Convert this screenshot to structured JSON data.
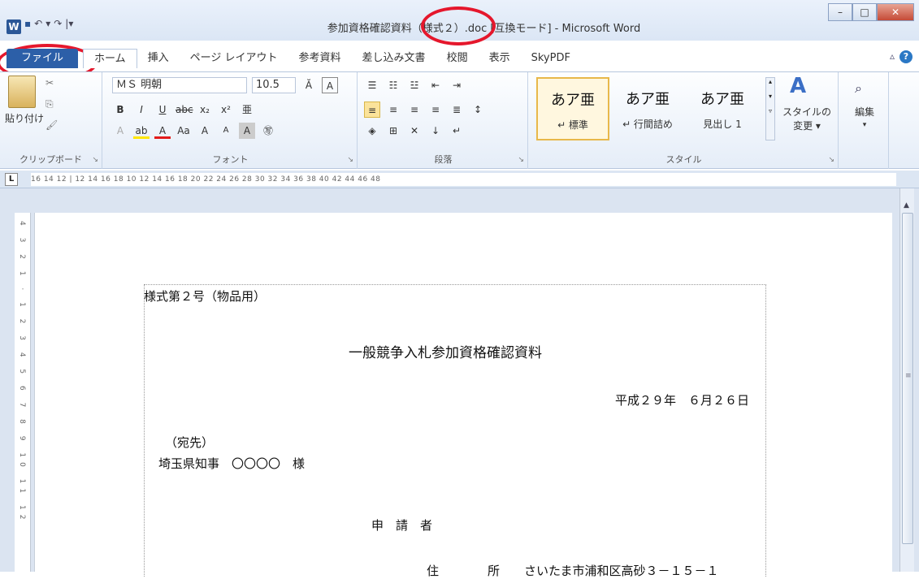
{
  "window": {
    "title": "参加資格確認資料（様式２）.doc [互換モード] - Microsoft Word",
    "app_icon": "W",
    "quick_access": [
      "save-icon",
      "undo-icon",
      "redo-icon",
      "customize-icon"
    ],
    "controls": [
      "minimize",
      "maximize",
      "close"
    ]
  },
  "ribbon_tabs": [
    "ファイル",
    "ホーム",
    "挿入",
    "ページ レイアウト",
    "参考資料",
    "差し込み文書",
    "校閲",
    "表示",
    "SkyPDF"
  ],
  "active_tab": "ホーム",
  "ribbon": {
    "clipboard": {
      "paste_label": "貼り付け",
      "group_label": "クリップボード"
    },
    "font": {
      "font_name": "ＭＳ 明朝",
      "font_size": "10.5",
      "group_label": "フォント",
      "buttons_row2": [
        "B",
        "I",
        "U",
        "abc",
        "x₂",
        "x²"
      ],
      "buttons_row3": [
        "Aa",
        "A",
        "A"
      ]
    },
    "paragraph": {
      "group_label": "段落"
    },
    "styles": {
      "group_label": "スタイル",
      "items": [
        {
          "sample": "あア亜",
          "name": "↵ 標準",
          "selected": true
        },
        {
          "sample": "あア亜",
          "name": "↵ 行間詰め",
          "selected": false
        },
        {
          "sample": "あア亜",
          "name": "見出し 1",
          "selected": false
        }
      ],
      "change_styles": "スタイルの\n変更 ▾"
    },
    "editing": {
      "label": "編集"
    }
  },
  "ruler": {
    "h_marks": "16  14  12   |  12  14  16  18  10  12  14  16  18  20  22  24  26  28  30  32  34  36  38  40  42  44  46  48"
  },
  "document": {
    "lines": [
      {
        "id": "form-number",
        "text": "様式第２号（物品用）"
      },
      {
        "id": "doc-title",
        "text": "一般競争入札参加資格確認資料"
      },
      {
        "id": "date",
        "text": "平成２９年　６月２６日"
      },
      {
        "id": "addressee-label",
        "text": "（宛先）"
      },
      {
        "id": "addressee",
        "text": "埼玉県知事　〇〇〇〇　様"
      },
      {
        "id": "applicant",
        "text": "申　請　者"
      },
      {
        "id": "address",
        "text": "住　　　　所　　さいたま市浦和区高砂３－１５－１"
      }
    ]
  },
  "colors": {
    "file_tab": "#2c5fa8",
    "highlight_circle": "#e5172c",
    "style_selected": "#e8b84a"
  }
}
